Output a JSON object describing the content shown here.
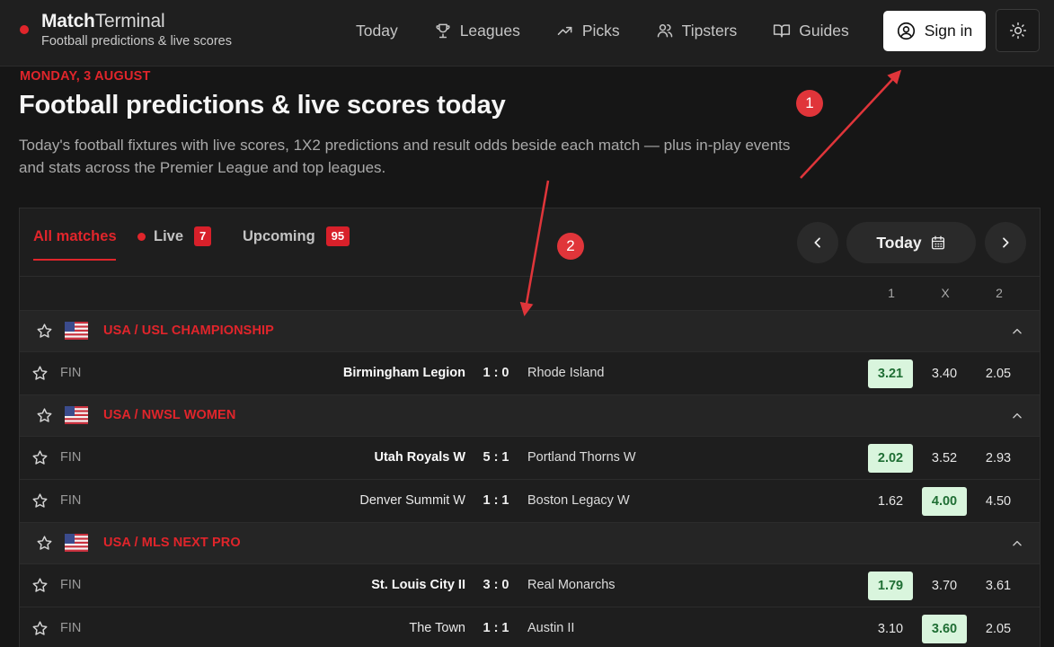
{
  "brand": {
    "name_bold": "Match",
    "name_light": "Terminal",
    "tagline": "Football predictions & live scores"
  },
  "nav": [
    {
      "label": "Today",
      "icon": "none"
    },
    {
      "label": "Leagues",
      "icon": "trophy-icon"
    },
    {
      "label": "Picks",
      "icon": "trend-icon"
    },
    {
      "label": "Tipsters",
      "icon": "users-icon"
    },
    {
      "label": "Guides",
      "icon": "book-icon"
    }
  ],
  "header": {
    "sign_in": "Sign in"
  },
  "hero": {
    "date": "MONDAY, 3 AUGUST",
    "title": "Football predictions & live scores today",
    "description": "Today's football fixtures with live scores, 1X2 predictions and result odds beside each match — plus in-play events and stats across the Premier League and top leagues."
  },
  "tabs": {
    "all": "All matches",
    "live": "Live",
    "live_count": "7",
    "upcoming": "Upcoming",
    "upcoming_count": "95"
  },
  "date_nav": {
    "label": "Today"
  },
  "odds_header": {
    "home": "1",
    "draw": "X",
    "away": "2"
  },
  "leagues": [
    {
      "name": "USA / USL CHAMPIONSHIP",
      "matches": [
        {
          "status": "FIN",
          "home": "Birmingham Legion",
          "score": "1 : 0",
          "away": "Rhode Island",
          "odd1": "3.21",
          "oddx": "3.40",
          "odd2": "2.05"
        }
      ]
    },
    {
      "name": "USA / NWSL WOMEN",
      "matches": [
        {
          "status": "FIN",
          "home": "Utah Royals W",
          "score": "5 : 1",
          "away": "Portland Thorns W",
          "odd1": "2.02",
          "oddx": "3.52",
          "odd2": "2.93"
        },
        {
          "status": "FIN",
          "home": "Denver Summit W",
          "score": "1 : 1",
          "away": "Boston Legacy W",
          "odd1": "1.62",
          "oddx": "4.00",
          "odd2": "4.50"
        }
      ]
    },
    {
      "name": "USA / MLS NEXT PRO",
      "matches": [
        {
          "status": "FIN",
          "home": "St. Louis City II",
          "score": "3 : 0",
          "away": "Real Monarchs",
          "odd1": "1.79",
          "oddx": "3.70",
          "odd2": "3.61"
        },
        {
          "status": "FIN",
          "home": "The Town",
          "score": "1 : 1",
          "away": "Austin II",
          "odd1": "3.10",
          "oddx": "3.60",
          "odd2": "2.05"
        }
      ]
    }
  ],
  "annotations": {
    "marker_1": "1",
    "marker_2": "2"
  },
  "colors": {
    "accent": "#e0252b",
    "odds_highlight_bg": "#d9f5dd",
    "odds_highlight_text": "#1f6e34"
  }
}
